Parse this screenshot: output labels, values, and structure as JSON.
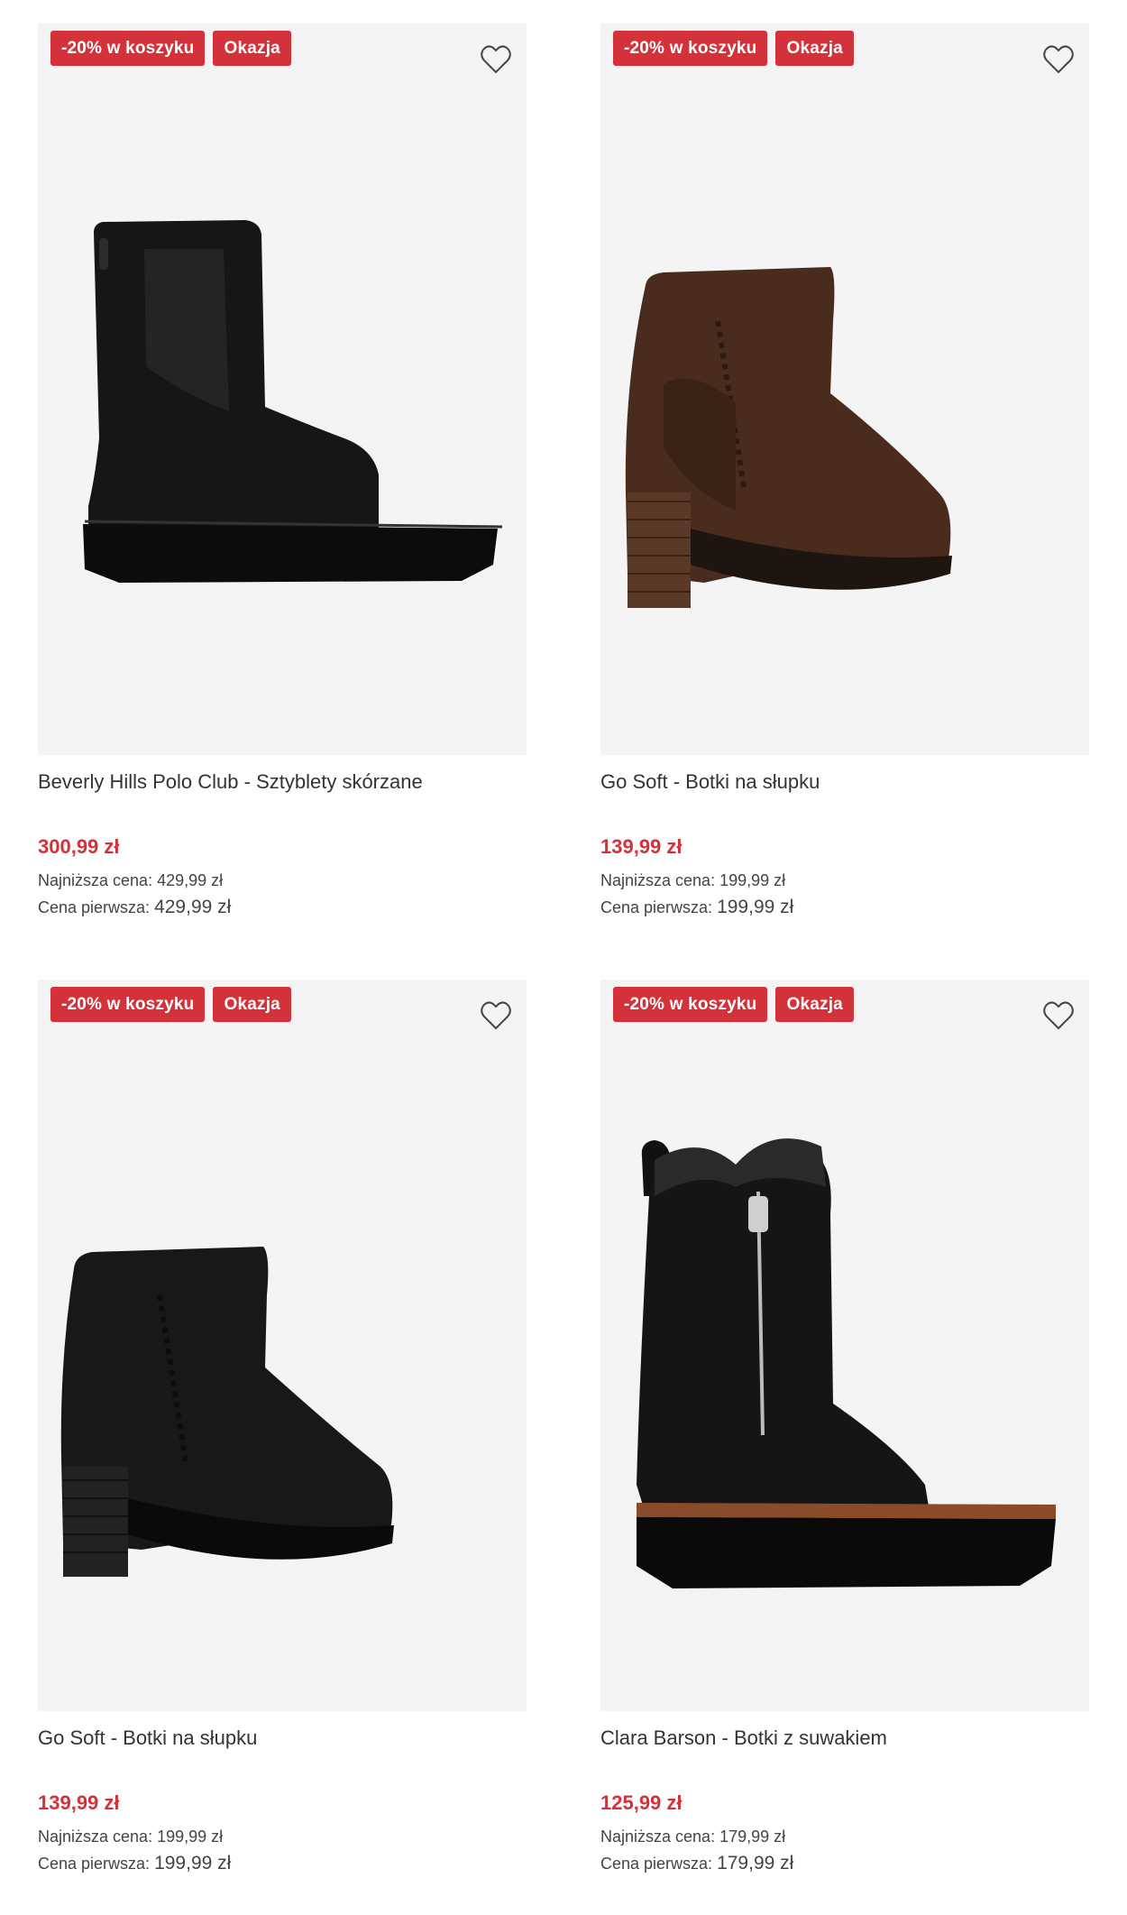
{
  "products": [
    {
      "badges": [
        "-20% w koszyku",
        "Okazja"
      ],
      "title": "Beverly Hills Polo Club - Sztyblety skórzane",
      "price": "300,99 zł",
      "lowest_label": "Najniższa cena:",
      "lowest_value": "429,99 zł",
      "original_label": "Cena pierwsza:",
      "original_value": "429,99 zł",
      "image_icon": "black-chelsea-boot"
    },
    {
      "badges": [
        "-20% w koszyku",
        "Okazja"
      ],
      "title": "Go Soft - Botki na słupku",
      "price": "139,99 zł",
      "lowest_label": "Najniższa cena:",
      "lowest_value": "199,99 zł",
      "original_label": "Cena pierwsza:",
      "original_value": "199,99 zł",
      "image_icon": "brown-heeled-ankle-boot"
    },
    {
      "badges": [
        "-20% w koszyku",
        "Okazja"
      ],
      "title": "Go Soft - Botki na słupku",
      "price": "139,99 zł",
      "lowest_label": "Najniższa cena:",
      "lowest_value": "199,99 zł",
      "original_label": "Cena pierwsza:",
      "original_value": "199,99 zł",
      "image_icon": "black-heeled-ankle-boot"
    },
    {
      "badges": [
        "-20% w koszyku",
        "Okazja"
      ],
      "title": "Clara Barson - Botki z suwakiem",
      "price": "125,99 zł",
      "lowest_label": "Najniższa cena:",
      "lowest_value": "179,99 zł",
      "original_label": "Cena pierwsza:",
      "original_value": "179,99 zł",
      "image_icon": "black-fur-zip-boot"
    }
  ],
  "colors": {
    "badge": "#d3323a",
    "price": "#d3323a",
    "image_bg": "#f4f4f4"
  }
}
